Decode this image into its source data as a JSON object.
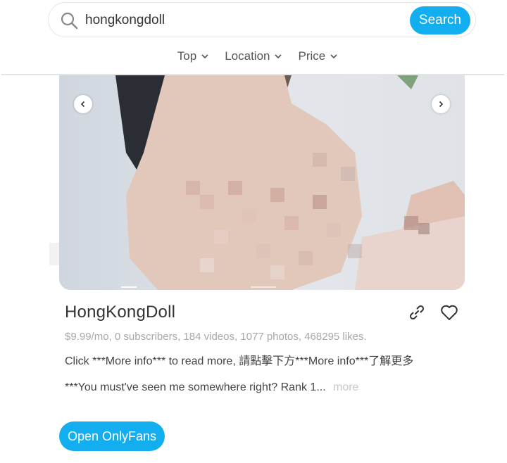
{
  "search": {
    "value": "hongkongdoll",
    "button_label": "Search"
  },
  "filters": [
    {
      "label": "Top"
    },
    {
      "label": "Location"
    },
    {
      "label": "Price"
    }
  ],
  "carousel": {
    "prev_icon": "chevron-left-icon",
    "next_icon": "chevron-right-icon"
  },
  "profile": {
    "name": "HongKongDoll",
    "stats": "$9.99/mo, 0 subscribers, 184 videos, 1077 photos, 468295 likes.",
    "description_line1": "Click ***More info*** to read more, 請點擊下方***More info***了解更多",
    "description_line2": "***You must've seen me somewhere right? Rank 1...",
    "more_label": "more",
    "open_button_label": "Open OnlyFans"
  },
  "colors": {
    "accent": "#12aef0",
    "muted_text": "#a8a8a8"
  }
}
